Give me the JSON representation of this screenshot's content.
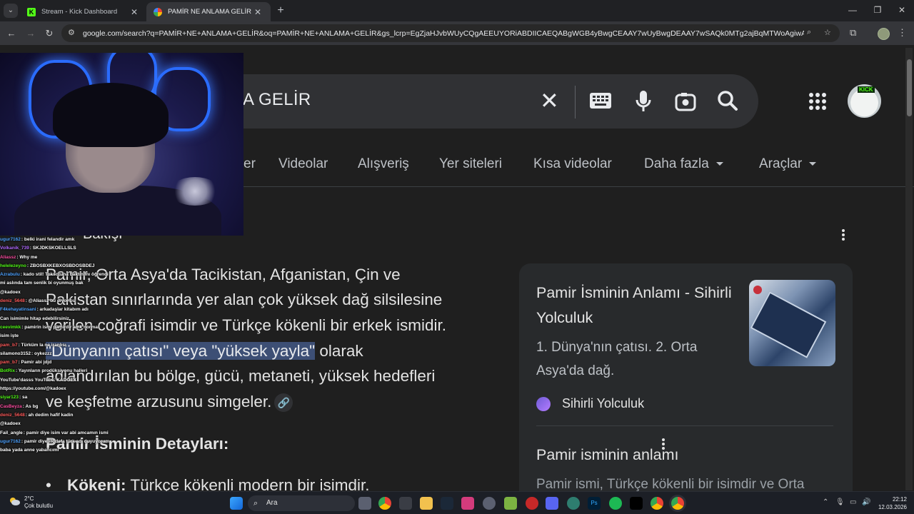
{
  "colors": {
    "kick_green": "#53fc18",
    "google_g": "#4285f4",
    "highlight": "#3d4f75",
    "card_bg": "#282a2c"
  },
  "browser": {
    "tabs": [
      {
        "title": "Stream - Kick Dashboard",
        "favicon": "kick-logo-icon",
        "active": false
      },
      {
        "title": "PAMİR NE ANLAMA GELİR - Go",
        "favicon": "google-logo-icon",
        "active": true
      }
    ],
    "url": "google.com/search?q=PAMİR+NE+ANLAMA+GELİR&oq=PAMİR+NE+ANLAMA+GELİR&gs_lcrp=EgZjaHJvbWUyCQgAEEUYORiABDIICAEQABgWGB4yBwgCEAAY7wUyBwgDEAAY7wSAQk0MTg2ajBqMTWoAgiwAgHxBR..."
  },
  "search": {
    "query_visible": "A GELİR",
    "nav_tabs": [
      "er",
      "Videolar",
      "Alışveriş",
      "Yer siteleri",
      "Kısa videolar",
      "Daha fazla",
      "Araçlar"
    ]
  },
  "result": {
    "partial_heading": "Bakışı",
    "lines": [
      "Pamir, Orta Asya'da Tacikistan, Afganistan, Çin ve",
      "Pakistan sınırlarında yer alan çok yüksek dağ silsilesine",
      "verilen coğrafi isimdir ve Türkçe kökenli bir erkek ismidir."
    ],
    "highlight": "\"Dünyanın çatısı\" veya \"yüksek yayla\"",
    "line4_rest": " olarak",
    "line5": "adlandırılan bu bölge, gücü, metaneti, yüksek hedefleri",
    "line6": "ve keşfetme arzusunu simgeler.",
    "details_heading": "Pamir İsminin Detayları:",
    "bullet_label": "Kökeni:",
    "bullet_text": " Türkçe kökenli modern bir isimdir."
  },
  "side_card": {
    "title": "Pamir İsminin Anlamı - Sihirli Yolculuk",
    "description": "1. Dünya'nın çatısı. 2. Orta Asya'da dağ.",
    "source": "Sihirli Yolculuk",
    "title2": "Pamir isminin anlamı",
    "description2": "Pamir ismi, Türkçe kökenli bir isimdir ve Orta"
  },
  "chat": [
    {
      "user": "ugur7162",
      "color": "#4fa3ff",
      "text": ": belki irani felandir amk"
    },
    {
      "user": "Volkanik_739",
      "color": "#b26bff",
      "text": ": SKJDKSKOELLSLS"
    },
    {
      "user": "Aliassz",
      "color": "#ff4fa3",
      "text": ": Why me"
    },
    {
      "user": "helelezeyno",
      "color": "#53fc18",
      "text": ": ZBOSBXKEBXOSBDOSBDEJ"
    },
    {
      "user": "Azrabulu",
      "color": "#4fa3ff",
      "text": ": kado stil! Toksoruna baktın mı öğrendi"
    },
    {
      "user": "",
      "color": "#ffffff",
      "text": "mi aslında tam senlik bi oyunmuş bak"
    },
    {
      "user": "",
      "color": "#ffffff",
      "text": "@kadoex"
    },
    {
      "user": "deniz_5648",
      "color": "#ff5b5b",
      "text": ": @Aliassz bu diyor bu"
    },
    {
      "user": "F4kehayatinsani",
      "color": "#4fa3ff",
      "text": ": arkadaşlar kitabım adı"
    },
    {
      "user": "",
      "color": "#ffffff",
      "text": "Can isimimle hitap edebilirsiniz"
    },
    {
      "user": "ceevimkk",
      "color": "#53fc18",
      "text": ": pamirin ismi pamirdir amk normal"
    },
    {
      "user": "",
      "color": "#ffffff",
      "text": "isim işte"
    },
    {
      "user": "pam_b7",
      "color": "#ff5b5b",
      "text": ": Türküm la ne iranlısı"
    },
    {
      "user": "silamono3152",
      "color": "#ffffff",
      "text": ": oykezzz"
    },
    {
      "user": "pam_b7",
      "color": "#ff5b5b",
      "text": ": Pamir abi jdjd"
    },
    {
      "user": "BotRix",
      "color": "#53fc18",
      "text": ": Yayınların prodüksiyonu halleri"
    },
    {
      "user": "",
      "color": "#ffffff",
      "text": "YouTube'dasss YouTube: KADOEX"
    },
    {
      "user": "",
      "color": "#ffffff",
      "text": "https://youtube.com/@kadoex"
    },
    {
      "user": "siyar123",
      "color": "#53fc18",
      "text": ": sa"
    },
    {
      "user": "CasBeyza",
      "color": "#ff4fa3",
      "text": ": As bg"
    },
    {
      "user": "deniz_5648",
      "color": "#ff5b5b",
      "text": ": ah dedim hafif kadin"
    },
    {
      "user": "",
      "color": "#ffffff",
      "text": "@kadoex"
    },
    {
      "user": "Fail_angle",
      "color": "#ffffff",
      "text": ": pamir diye isim var abi amcamın ismi"
    },
    {
      "user": "ugur7162",
      "color": "#4fa3ff",
      "text": ": pamir diye ilk defa türk adı duyuyorum"
    },
    {
      "user": "",
      "color": "#ffffff",
      "text": "baba yada anne yabancımı"
    }
  ],
  "taskbar": {
    "temperature": "2°C",
    "weather": "Çok bulutlu",
    "search_label": "Ara",
    "time": "22:12",
    "date": "12.03.2026"
  }
}
